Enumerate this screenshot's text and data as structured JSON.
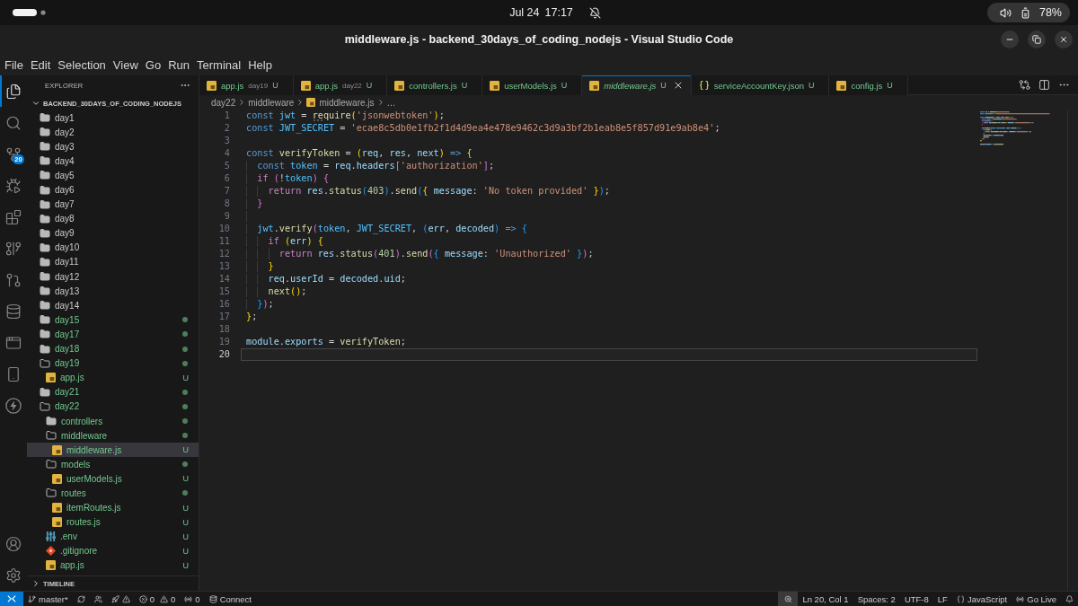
{
  "system_bar": {
    "date": "Jul 24",
    "time": "17:17",
    "battery": "78%"
  },
  "window": {
    "title": "middleware.js - backend_30days_of_coding_nodejs - Visual Studio Code"
  },
  "menu": [
    "File",
    "Edit",
    "Selection",
    "View",
    "Go",
    "Run",
    "Terminal",
    "Help"
  ],
  "activity_bar": {
    "top": [
      {
        "kind": "explorer",
        "selected": true
      },
      {
        "kind": "search",
        "selected": false
      },
      {
        "kind": "scm",
        "selected": false,
        "badge": "20"
      },
      {
        "kind": "debug",
        "selected": false
      },
      {
        "kind": "extensions",
        "selected": false
      },
      {
        "kind": "graph",
        "selected": false
      },
      {
        "kind": "history",
        "selected": false
      },
      {
        "kind": "database",
        "selected": false
      },
      {
        "kind": "remote",
        "selected": false
      },
      {
        "kind": "device",
        "selected": false
      },
      {
        "kind": "thunder",
        "selected": false
      }
    ],
    "bottom": [
      {
        "kind": "account"
      },
      {
        "kind": "settings"
      }
    ]
  },
  "explorer": {
    "title": "EXPLORER",
    "root": {
      "name": "BACKEND_30DAYS_OF_CODING_NODEJS",
      "expanded": true,
      "children": [
        {
          "name": "day1",
          "kind": "folder",
          "expanded": false,
          "changed": false,
          "selected": false
        },
        {
          "name": "day2",
          "kind": "folder",
          "expanded": false,
          "changed": false,
          "selected": false
        },
        {
          "name": "day3",
          "kind": "folder",
          "expanded": false,
          "changed": false,
          "selected": false
        },
        {
          "name": "day4",
          "kind": "folder",
          "expanded": false,
          "changed": false,
          "selected": false
        },
        {
          "name": "day5",
          "kind": "folder",
          "expanded": false,
          "changed": false,
          "selected": false
        },
        {
          "name": "day6",
          "kind": "folder",
          "expanded": false,
          "changed": false,
          "selected": false
        },
        {
          "name": "day7",
          "kind": "folder",
          "expanded": false,
          "changed": false,
          "selected": false
        },
        {
          "name": "day8",
          "kind": "folder",
          "expanded": false,
          "changed": false,
          "selected": false
        },
        {
          "name": "day9",
          "kind": "folder",
          "expanded": false,
          "changed": false,
          "selected": false
        },
        {
          "name": "day10",
          "kind": "folder",
          "expanded": false,
          "changed": false,
          "selected": false
        },
        {
          "name": "day11",
          "kind": "folder",
          "expanded": false,
          "changed": false,
          "selected": false
        },
        {
          "name": "day12",
          "kind": "folder",
          "expanded": false,
          "changed": false,
          "selected": false
        },
        {
          "name": "day13",
          "kind": "folder",
          "expanded": false,
          "changed": false,
          "selected": false
        },
        {
          "name": "day14",
          "kind": "folder",
          "expanded": false,
          "changed": false,
          "selected": false
        },
        {
          "name": "day15",
          "kind": "folder",
          "expanded": false,
          "changed": true,
          "selected": false
        },
        {
          "name": "day17",
          "kind": "folder",
          "expanded": false,
          "changed": true,
          "selected": false
        },
        {
          "name": "day18",
          "kind": "folder",
          "expanded": false,
          "changed": true,
          "selected": false
        },
        {
          "name": "day19",
          "kind": "folder",
          "expanded": true,
          "changed": true,
          "selected": false,
          "children": [
            {
              "name": "app.js",
              "kind": "js",
              "badge": "U",
              "selected": false
            }
          ]
        },
        {
          "name": "day21",
          "kind": "folder",
          "expanded": false,
          "changed": true,
          "selected": false
        },
        {
          "name": "day22",
          "kind": "folder",
          "expanded": true,
          "changed": true,
          "selected": false,
          "children": [
            {
              "name": "controllers",
              "kind": "folder",
              "expanded": false,
              "changed": true,
              "selected": false
            },
            {
              "name": "middleware",
              "kind": "folder",
              "expanded": true,
              "changed": true,
              "selected": false,
              "children": [
                {
                  "name": "middleware.js",
                  "kind": "js",
                  "badge": "U",
                  "selected": true
                }
              ]
            },
            {
              "name": "models",
              "kind": "folder",
              "expanded": true,
              "changed": true,
              "selected": false,
              "children": [
                {
                  "name": "userModels.js",
                  "kind": "js",
                  "badge": "U",
                  "selected": false
                }
              ]
            },
            {
              "name": "routes",
              "kind": "folder",
              "expanded": true,
              "changed": true,
              "selected": false,
              "children": [
                {
                  "name": "itemRoutes.js",
                  "kind": "js",
                  "badge": "U",
                  "selected": false
                },
                {
                  "name": "routes.js",
                  "kind": "js",
                  "badge": "U",
                  "selected": false
                }
              ]
            },
            {
              "name": ".env",
              "kind": "env",
              "badge": "U",
              "selected": false
            },
            {
              "name": ".gitignore",
              "kind": "git",
              "badge": "U",
              "selected": false
            },
            {
              "name": "app.js",
              "kind": "js",
              "badge": "U",
              "selected": false
            }
          ]
        }
      ]
    },
    "timeline": {
      "title": "TIMELINE",
      "expanded": false
    }
  },
  "tabs": [
    {
      "label": "app.js",
      "description": "day19",
      "badge": "U",
      "kind": "js",
      "selected": false,
      "preview": false
    },
    {
      "label": "app.js",
      "description": "day22",
      "badge": "U",
      "kind": "js",
      "selected": false,
      "preview": false
    },
    {
      "label": "controllers.js",
      "badge": "U",
      "kind": "js",
      "selected": false,
      "preview": false
    },
    {
      "label": "userModels.js",
      "badge": "U",
      "kind": "js",
      "selected": false,
      "preview": false
    },
    {
      "label": "middleware.js",
      "badge": "U",
      "kind": "js",
      "selected": true,
      "preview": true
    },
    {
      "label": "serviceAccountKey.json",
      "badge": "U",
      "kind": "json",
      "selected": false,
      "preview": false
    },
    {
      "label": "config.js",
      "badge": "U",
      "kind": "js",
      "selected": false,
      "preview": false
    }
  ],
  "breadcrumb": [
    {
      "label": "day22",
      "kind": "folder"
    },
    {
      "label": "middleware",
      "kind": "folder"
    },
    {
      "label": "middleware.js",
      "kind": "js"
    },
    {
      "label": "…",
      "kind": "symbols"
    }
  ],
  "editor": {
    "lines": [
      {
        "number": "1",
        "current": false,
        "tokens": [
          {
            "text": "const ",
            "kind": "keyword"
          },
          {
            "text": "jwt",
            "kind": "constant"
          },
          {
            "text": " = ",
            "kind": "plain"
          },
          {
            "text": "require",
            "kind": "function",
            "hint": true
          },
          {
            "text": "(",
            "kind": "bracket1"
          },
          {
            "text": "'jsonwebtoken'",
            "kind": "string"
          },
          {
            "text": ")",
            "kind": "bracket1"
          },
          {
            "text": ";",
            "kind": "plain"
          }
        ]
      },
      {
        "number": "2",
        "current": false,
        "tokens": [
          {
            "text": "const ",
            "kind": "keyword"
          },
          {
            "text": "JWT_SECRET",
            "kind": "constant"
          },
          {
            "text": " = ",
            "kind": "plain"
          },
          {
            "text": "'ecae8c5db0e1fb2f1d4d9ea4e478e9462c3d9a3bf2b1eab8e5f857d91e9ab8e4'",
            "kind": "string"
          },
          {
            "text": ";",
            "kind": "plain"
          }
        ]
      },
      {
        "number": "3",
        "current": false
      },
      {
        "number": "4",
        "current": false,
        "tokens": [
          {
            "text": "const ",
            "kind": "keyword"
          },
          {
            "text": "verifyToken",
            "kind": "function"
          },
          {
            "text": " = ",
            "kind": "plain"
          },
          {
            "text": "(",
            "kind": "bracket1"
          },
          {
            "text": "req",
            "kind": "variable"
          },
          {
            "text": ", ",
            "kind": "plain"
          },
          {
            "text": "res",
            "kind": "variable"
          },
          {
            "text": ", ",
            "kind": "plain"
          },
          {
            "text": "next",
            "kind": "variable"
          },
          {
            "text": ")",
            "kind": "bracket1"
          },
          {
            "text": " => ",
            "kind": "keyword"
          },
          {
            "text": "{",
            "kind": "bracket1"
          }
        ]
      },
      {
        "number": "5",
        "current": false,
        "tokens": [
          {
            "text": "  const ",
            "kind": "keyword"
          },
          {
            "text": "token",
            "kind": "constant"
          },
          {
            "text": " = ",
            "kind": "plain"
          },
          {
            "text": "req",
            "kind": "variable"
          },
          {
            "text": ".",
            "kind": "plain"
          },
          {
            "text": "headers",
            "kind": "variable"
          },
          {
            "text": "[",
            "kind": "bracket2"
          },
          {
            "text": "'authorization'",
            "kind": "string"
          },
          {
            "text": "]",
            "kind": "bracket2"
          },
          {
            "text": ";",
            "kind": "plain"
          }
        ]
      },
      {
        "number": "6",
        "current": false,
        "tokens": [
          {
            "text": "  if ",
            "kind": "control"
          },
          {
            "text": "(",
            "kind": "bracket2"
          },
          {
            "text": "!",
            "kind": "plain"
          },
          {
            "text": "token",
            "kind": "constant"
          },
          {
            "text": ")",
            "kind": "bracket2"
          },
          {
            "text": " {",
            "kind": "bracket2"
          }
        ]
      },
      {
        "number": "7",
        "current": false,
        "tokens": [
          {
            "text": "    return ",
            "kind": "control"
          },
          {
            "text": "res",
            "kind": "variable"
          },
          {
            "text": ".",
            "kind": "plain"
          },
          {
            "text": "status",
            "kind": "function"
          },
          {
            "text": "(",
            "kind": "bracket3"
          },
          {
            "text": "403",
            "kind": "number"
          },
          {
            "text": ")",
            "kind": "bracket3"
          },
          {
            "text": ".",
            "kind": "plain"
          },
          {
            "text": "send",
            "kind": "function"
          },
          {
            "text": "(",
            "kind": "bracket3"
          },
          {
            "text": "{ ",
            "kind": "bracket1"
          },
          {
            "text": "message",
            "kind": "variable"
          },
          {
            "text": ": ",
            "kind": "plain"
          },
          {
            "text": "'No token provided'",
            "kind": "string"
          },
          {
            "text": " }",
            "kind": "bracket1"
          },
          {
            "text": ")",
            "kind": "bracket3"
          },
          {
            "text": ";",
            "kind": "plain"
          }
        ]
      },
      {
        "number": "8",
        "current": false,
        "tokens": [
          {
            "text": "  }",
            "kind": "bracket2"
          }
        ]
      },
      {
        "number": "9",
        "current": false
      },
      {
        "number": "10",
        "current": false,
        "tokens": [
          {
            "text": "  jwt",
            "kind": "constant"
          },
          {
            "text": ".",
            "kind": "plain"
          },
          {
            "text": "verify",
            "kind": "function"
          },
          {
            "text": "(",
            "kind": "bracket2"
          },
          {
            "text": "token",
            "kind": "constant"
          },
          {
            "text": ", ",
            "kind": "plain"
          },
          {
            "text": "JWT_SECRET",
            "kind": "constant"
          },
          {
            "text": ", ",
            "kind": "plain"
          },
          {
            "text": "(",
            "kind": "bracket3"
          },
          {
            "text": "err",
            "kind": "variable"
          },
          {
            "text": ", ",
            "kind": "plain"
          },
          {
            "text": "decoded",
            "kind": "variable"
          },
          {
            "text": ")",
            "kind": "bracket3"
          },
          {
            "text": " => ",
            "kind": "keyword"
          },
          {
            "text": "{",
            "kind": "bracket3"
          }
        ]
      },
      {
        "number": "11",
        "current": false,
        "tokens": [
          {
            "text": "    if ",
            "kind": "control"
          },
          {
            "text": "(",
            "kind": "bracket1"
          },
          {
            "text": "err",
            "kind": "variable"
          },
          {
            "text": ")",
            "kind": "bracket1"
          },
          {
            "text": " {",
            "kind": "bracket1"
          }
        ]
      },
      {
        "number": "12",
        "current": false,
        "tokens": [
          {
            "text": "      return ",
            "kind": "control"
          },
          {
            "text": "res",
            "kind": "variable"
          },
          {
            "text": ".",
            "kind": "plain"
          },
          {
            "text": "status",
            "kind": "function"
          },
          {
            "text": "(",
            "kind": "bracket2"
          },
          {
            "text": "401",
            "kind": "number"
          },
          {
            "text": ")",
            "kind": "bracket2"
          },
          {
            "text": ".",
            "kind": "plain"
          },
          {
            "text": "send",
            "kind": "function"
          },
          {
            "text": "(",
            "kind": "bracket2"
          },
          {
            "text": "{ ",
            "kind": "bracket3"
          },
          {
            "text": "message",
            "kind": "variable"
          },
          {
            "text": ": ",
            "kind": "plain"
          },
          {
            "text": "'Unauthorized'",
            "kind": "string"
          },
          {
            "text": " }",
            "kind": "bracket3"
          },
          {
            "text": ")",
            "kind": "bracket2"
          },
          {
            "text": ";",
            "kind": "plain"
          }
        ]
      },
      {
        "number": "13",
        "current": false,
        "tokens": [
          {
            "text": "    }",
            "kind": "bracket1"
          }
        ]
      },
      {
        "number": "14",
        "current": false,
        "tokens": [
          {
            "text": "    req",
            "kind": "variable"
          },
          {
            "text": ".",
            "kind": "plain"
          },
          {
            "text": "userId",
            "kind": "variable"
          },
          {
            "text": " = ",
            "kind": "plain"
          },
          {
            "text": "decoded",
            "kind": "variable"
          },
          {
            "text": ".",
            "kind": "plain"
          },
          {
            "text": "uid",
            "kind": "variable"
          },
          {
            "text": ";",
            "kind": "plain"
          }
        ]
      },
      {
        "number": "15",
        "current": false,
        "tokens": [
          {
            "text": "    next",
            "kind": "function"
          },
          {
            "text": "()",
            "kind": "bracket1"
          },
          {
            "text": ";",
            "kind": "plain"
          }
        ]
      },
      {
        "number": "16",
        "current": false,
        "tokens": [
          {
            "text": "  }",
            "kind": "bracket3"
          },
          {
            "text": ")",
            "kind": "bracket2"
          },
          {
            "text": ";",
            "kind": "plain"
          }
        ]
      },
      {
        "number": "17",
        "current": false,
        "tokens": [
          {
            "text": "}",
            "kind": "bracket1"
          },
          {
            "text": ";",
            "kind": "plain"
          }
        ]
      },
      {
        "number": "18",
        "current": false
      },
      {
        "number": "19",
        "current": false,
        "tokens": [
          {
            "text": "module",
            "kind": "variable"
          },
          {
            "text": ".",
            "kind": "plain"
          },
          {
            "text": "exports",
            "kind": "variable"
          },
          {
            "text": " = ",
            "kind": "plain"
          },
          {
            "text": "verifyToken",
            "kind": "function"
          },
          {
            "text": ";",
            "kind": "plain"
          }
        ]
      },
      {
        "number": "20",
        "current": true
      }
    ]
  },
  "status_bar": {
    "left": [
      {
        "kind": "remote"
      },
      {
        "kind": "branch",
        "text": "master*"
      },
      {
        "kind": "sync"
      },
      {
        "kind": "users"
      },
      {
        "kind": "deploy"
      },
      {
        "kind": "problems",
        "errors": "0",
        "warnings": "0"
      },
      {
        "kind": "ports",
        "text": "0"
      },
      {
        "kind": "database",
        "text": "Connect"
      }
    ],
    "right": [
      {
        "kind": "zoom"
      },
      {
        "kind": "position",
        "text": "Ln 20, Col 1"
      },
      {
        "kind": "indent",
        "text": "Spaces: 2"
      },
      {
        "kind": "encoding",
        "text": "UTF-8"
      },
      {
        "kind": "eol",
        "text": "LF"
      },
      {
        "kind": "language",
        "text": "JavaScript"
      },
      {
        "kind": "live",
        "text": "Go Live"
      },
      {
        "kind": "notifications"
      }
    ]
  }
}
